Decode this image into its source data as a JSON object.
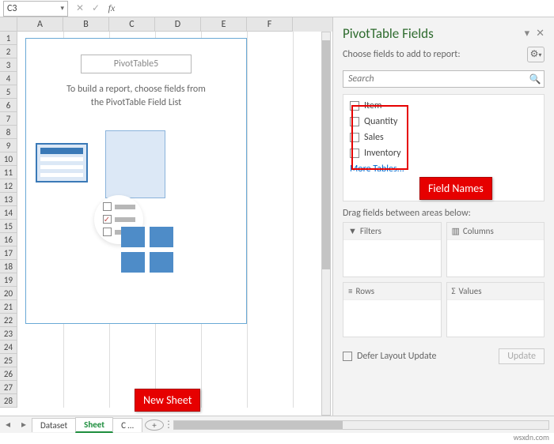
{
  "formula_bar": {
    "cell_ref": "C3",
    "cancel": "✕",
    "confirm": "✓",
    "fx": "fx",
    "value": ""
  },
  "columns": [
    "A",
    "B",
    "C",
    "D",
    "E",
    "F"
  ],
  "rows": [
    1,
    2,
    3,
    4,
    5,
    6,
    7,
    8,
    9,
    10,
    11,
    12,
    13,
    14,
    15,
    16,
    17,
    18,
    19,
    20,
    21,
    22,
    23,
    24,
    25,
    26,
    27,
    28
  ],
  "pivot_placeholder": {
    "title": "PivotTable5",
    "line1": "To build a report, choose fields from",
    "line2": "the PivotTable Field List"
  },
  "annotations": {
    "new_sheet": "New Sheet",
    "field_names": "Field Names"
  },
  "tabs": {
    "prev": "◂",
    "next": "▸",
    "items": [
      "Dataset",
      "Sheet",
      "C …"
    ],
    "active_index": 1,
    "add": "+"
  },
  "pane": {
    "title": "PivotTable Fields",
    "dropdown": "▾",
    "close": "✕",
    "choose": "Choose fields to add to report:",
    "gear": "⚙",
    "gear_dd": "▾",
    "search_placeholder": "Search",
    "fields": [
      "Item",
      "Quantity",
      "Sales",
      "Inventory"
    ],
    "more_tables": "More Tables...",
    "drag_text": "Drag fields between areas below:",
    "areas": {
      "filters": {
        "icon": "▼",
        "label": "Filters"
      },
      "columns": {
        "icon": "▥",
        "label": "Columns"
      },
      "rows": {
        "icon": "≡",
        "label": "Rows"
      },
      "values": {
        "icon": "Σ",
        "label": "Values"
      }
    },
    "defer": "Defer Layout Update",
    "update": "Update"
  },
  "watermark": "wsxdn.com"
}
